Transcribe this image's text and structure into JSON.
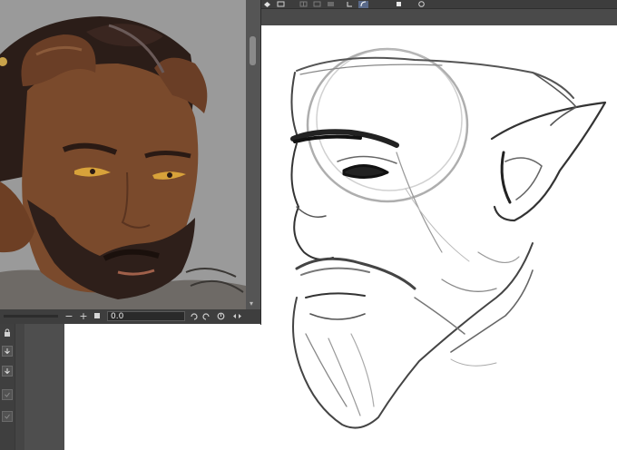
{
  "reference_window": {
    "rotation_value": "0.0",
    "zoom_out_symbol": "−",
    "zoom_in_symbol": "+"
  },
  "colors": {
    "ui_dark": "#3d3d3d",
    "ui_panel": "#484848",
    "ref_background": "#9a9a9a",
    "skin": "#7a4a2c",
    "hair": "#2e1f1a",
    "horn": "#6a3e26",
    "eye": "#d8a23a",
    "canvas": "#ffffff"
  },
  "icons": {
    "topbar": [
      "layer-icon",
      "frame-icon",
      "grid-icon",
      "crop-icon",
      "ruler-icon",
      "bracket-icon",
      "curve-icon",
      "copy-icon",
      "speech-icon"
    ],
    "status": [
      "rotate-left-icon",
      "rotate-right-icon",
      "reset-rotation-icon",
      "flip-icon"
    ],
    "layer_panel": [
      "lock-icon",
      "move-down-icon",
      "move-down-alt-icon",
      "checkbox-icon",
      "checkbox-alt-icon"
    ]
  }
}
